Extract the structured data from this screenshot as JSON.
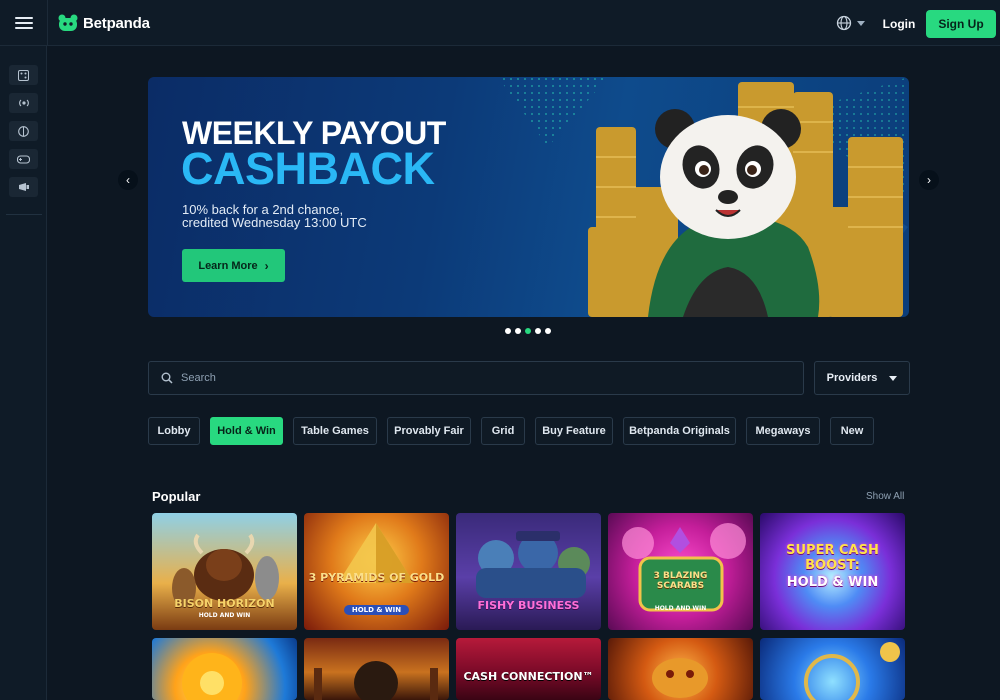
{
  "brand": {
    "name": "Betpanda",
    "accent": "#28d980"
  },
  "header": {
    "login_label": "Login",
    "signup_label": "Sign Up",
    "language_icon": "globe-icon"
  },
  "sidebar": {
    "items": [
      {
        "icon": "casino-icon"
      },
      {
        "icon": "live-icon"
      },
      {
        "icon": "sports-icon"
      },
      {
        "icon": "esports-icon"
      },
      {
        "icon": "promotions-icon"
      }
    ]
  },
  "banner": {
    "title_line1": "WEEKLY PAYOUT",
    "title_line2": "CASHBACK",
    "subtitle_line1": "10% back for a 2nd chance,",
    "subtitle_line2": "credited Wednesday 13:00 UTC",
    "cta_label": "Learn More",
    "slide_count": 5,
    "active_slide": 3
  },
  "search": {
    "placeholder": "Search"
  },
  "providers_label": "Providers",
  "tabs": [
    {
      "label": "Lobby"
    },
    {
      "label": "Hold & Win",
      "active": true
    },
    {
      "label": "Table Games"
    },
    {
      "label": "Provably Fair"
    },
    {
      "label": "Grid"
    },
    {
      "label": "Buy Feature"
    },
    {
      "label": "Betpanda Originals"
    },
    {
      "label": "Megaways"
    },
    {
      "label": "New"
    }
  ],
  "popular": {
    "title": "Popular",
    "show_all_label": "Show All",
    "games": [
      {
        "title": "BISON HORIZON",
        "subtitle": "HOLD AND WIN"
      },
      {
        "title": "3 PYRAMIDS OF GOLD",
        "subtitle": "HOLD & WIN"
      },
      {
        "title": "FISHY BUSINESS",
        "subtitle": ""
      },
      {
        "title": "3 BLAZING SCARABS",
        "subtitle": "HOLD AND WIN"
      },
      {
        "title": "SUPER CASH BOOST:",
        "subtitle": "HOLD & WIN"
      },
      {
        "title": "",
        "subtitle": ""
      },
      {
        "title": "",
        "subtitle": ""
      },
      {
        "title": "CASH CONNECTION™",
        "subtitle": ""
      },
      {
        "title": "",
        "subtitle": ""
      },
      {
        "title": "",
        "subtitle": ""
      }
    ]
  }
}
